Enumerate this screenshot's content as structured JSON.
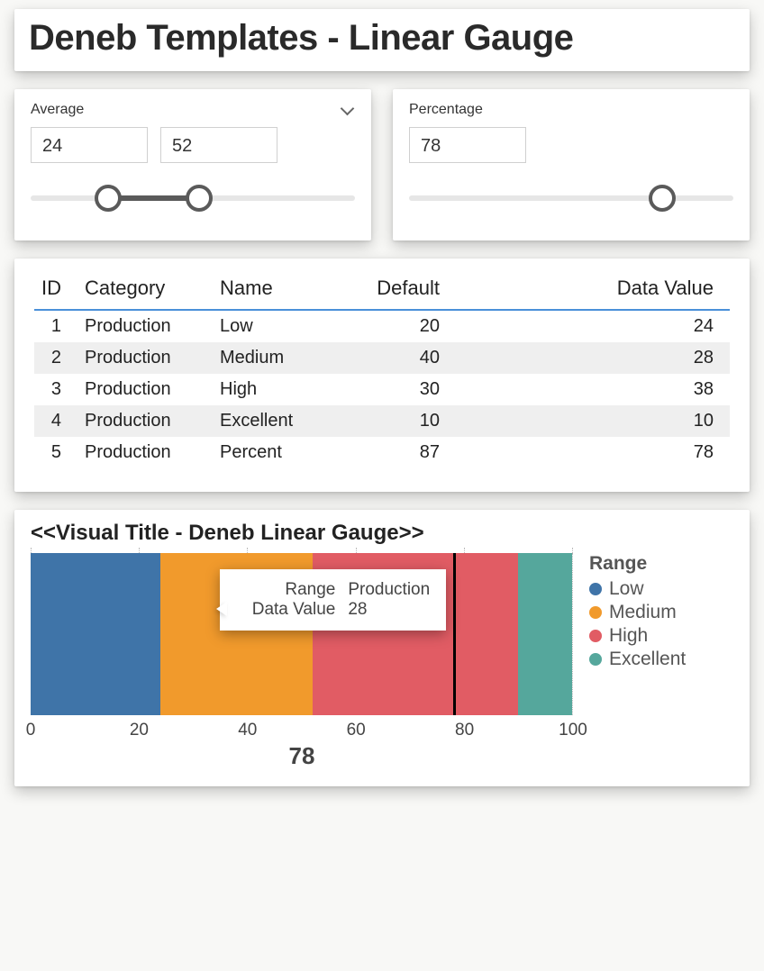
{
  "header": {
    "title": "Deneb Templates - Linear Gauge"
  },
  "slicers": {
    "average": {
      "label": "Average",
      "lo": "24",
      "hi": "52",
      "lo_pct": 24,
      "hi_pct": 52
    },
    "percentage": {
      "label": "Percentage",
      "value": "78",
      "pct": 78
    }
  },
  "table": {
    "headers": {
      "id": "ID",
      "category": "Category",
      "name": "Name",
      "def": "Default",
      "dv": "Data Value"
    },
    "rows": [
      {
        "id": "1",
        "category": "Production",
        "name": "Low",
        "def": "20",
        "dv": "24"
      },
      {
        "id": "2",
        "category": "Production",
        "name": "Medium",
        "def": "40",
        "dv": "28"
      },
      {
        "id": "3",
        "category": "Production",
        "name": "High",
        "def": "30",
        "dv": "38"
      },
      {
        "id": "4",
        "category": "Production",
        "name": "Excellent",
        "def": "10",
        "dv": "10"
      },
      {
        "id": "5",
        "category": "Production",
        "name": "Percent",
        "def": "87",
        "dv": "78"
      }
    ]
  },
  "gauge": {
    "title": "<<Visual Title - Deneb Linear Gauge>>",
    "legend_title": "Range",
    "value_label": "78",
    "ticks": [
      "0",
      "20",
      "40",
      "60",
      "80",
      "100"
    ],
    "tooltip": {
      "range_label": "Range",
      "range_value": "Production",
      "dv_label": "Data Value",
      "dv_value": "28"
    }
  },
  "chart_data": {
    "type": "bar",
    "title": "<<Visual Title - Deneb Linear Gauge>>",
    "xlabel": "",
    "ylabel": "",
    "xlim": [
      0,
      100
    ],
    "marker_value": 78,
    "series": [
      {
        "name": "Low",
        "value": 24,
        "color": "#3f74a8"
      },
      {
        "name": "Medium",
        "value": 28,
        "color": "#f19a2c"
      },
      {
        "name": "High",
        "value": 38,
        "color": "#e15c64"
      },
      {
        "name": "Excellent",
        "value": 10,
        "color": "#55a79c"
      }
    ],
    "tooltip": {
      "series": "Medium",
      "Range": "Production",
      "Data Value": 28
    }
  }
}
